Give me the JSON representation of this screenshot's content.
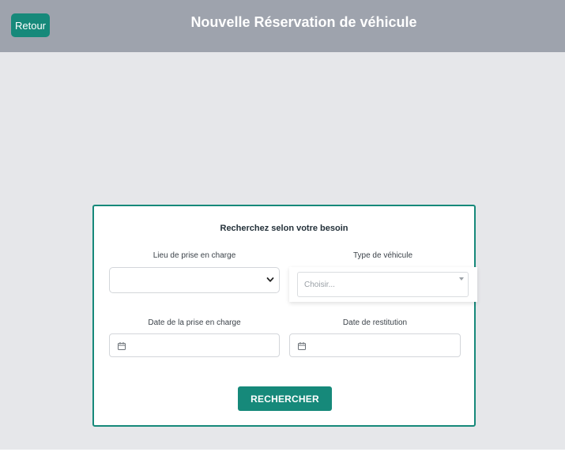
{
  "header": {
    "back_label": "Retour",
    "title": "Nouvelle Réservation de véhicule"
  },
  "form": {
    "title": "Recherchez selon votre besoin",
    "pickup_location": {
      "label": "Lieu de prise en charge",
      "value": ""
    },
    "vehicle_type": {
      "label": "Type de véhicule",
      "placeholder": "Choisir..."
    },
    "pickup_date": {
      "label": "Date de la prise en charge",
      "value": ""
    },
    "return_date": {
      "label": "Date de restitution",
      "value": ""
    },
    "search_label": "RECHERCHER"
  },
  "colors": {
    "header_bg": "#9ea3ad",
    "accent": "#16897a",
    "page_bg": "#e6e7ea"
  },
  "icons": {
    "select_chevron": "chevron-down-icon",
    "date_picker": "calendar-icon",
    "choice_caret": "caret-down-icon"
  }
}
